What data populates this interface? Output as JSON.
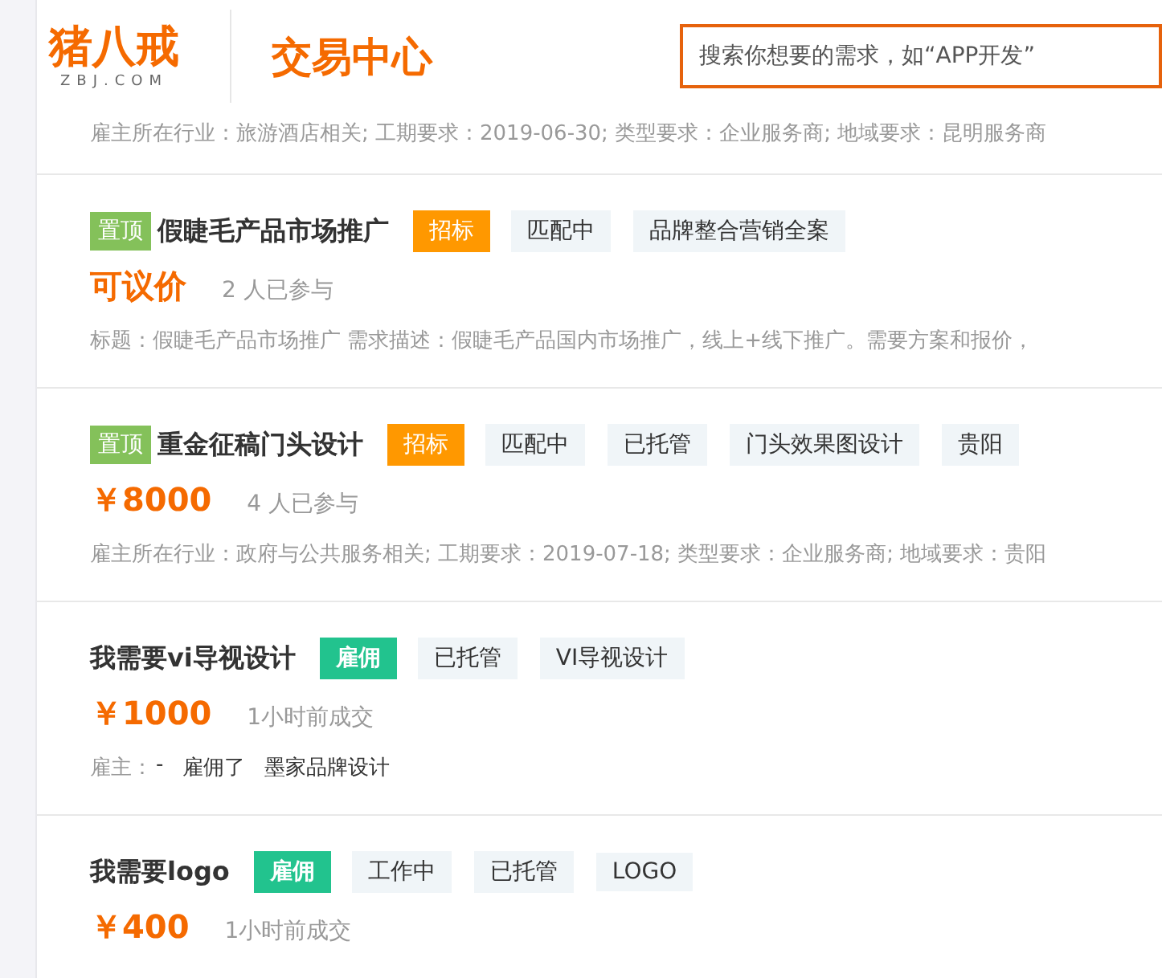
{
  "header": {
    "logo": {
      "name": "猪八戒",
      "domain": "ZBJ.COM"
    },
    "section_title": "交易中心",
    "search": {
      "placeholder": "搜索你想要的需求，如“APP开发”"
    }
  },
  "cut_line": "雇主所在行业：旅游酒店相关; 工期要求：2019-06-30; 类型要求：企业服务商; 地域要求：昆明服务商",
  "listings": [
    {
      "pin": "置顶",
      "title": "假睫毛产品市场推广",
      "tags": [
        {
          "kind": "bid",
          "text": "招标"
        },
        {
          "kind": "plain",
          "text": "匹配中"
        },
        {
          "kind": "plain",
          "text": "品牌整合营销全案"
        }
      ],
      "price": "可议价",
      "note": "2 人已参与",
      "details": [
        {
          "kind": "text",
          "text": "标题：假睫毛产品市场推广 需求描述：假睫毛产品国内市场推广，线上+线下推广。需要方案和报价，"
        }
      ]
    },
    {
      "pin": "置顶",
      "title": "重金征稿门头设计",
      "tags": [
        {
          "kind": "bid",
          "text": "招标"
        },
        {
          "kind": "plain",
          "text": "匹配中"
        },
        {
          "kind": "plain",
          "text": "已托管"
        },
        {
          "kind": "plain",
          "text": "门头效果图设计"
        },
        {
          "kind": "plain",
          "text": "贵阳"
        }
      ],
      "price": "￥8000",
      "note": "4 人已参与",
      "details": [
        {
          "kind": "text",
          "text": "雇主所在行业：政府与公共服务相关; 工期要求：2019-07-18; 类型要求：企业服务商; 地域要求：贵阳"
        }
      ]
    },
    {
      "title": "我需要vi导视设计",
      "tags": [
        {
          "kind": "hire",
          "text": "雇佣"
        },
        {
          "kind": "plain",
          "text": "已托管"
        },
        {
          "kind": "plain",
          "text": "VI导视设计"
        }
      ],
      "price": "￥1000",
      "note": "1小时前成交",
      "details": [
        {
          "kind": "label",
          "text": "雇主："
        },
        {
          "kind": "value",
          "text": "-"
        },
        {
          "kind": "value",
          "text": "雇佣了"
        },
        {
          "kind": "value",
          "text": "墨家品牌设计"
        }
      ]
    },
    {
      "title": "我需要logo",
      "tags": [
        {
          "kind": "hire",
          "text": "雇佣"
        },
        {
          "kind": "plain",
          "text": "工作中"
        },
        {
          "kind": "plain",
          "text": "已托管"
        },
        {
          "kind": "plain",
          "text": "LOGO"
        }
      ],
      "price": "￥400",
      "note": "1小时前成交"
    }
  ]
}
